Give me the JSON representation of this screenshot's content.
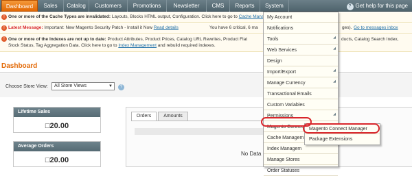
{
  "nav": {
    "items": [
      "Dashboard",
      "Sales",
      "Catalog",
      "Customers",
      "Promotions",
      "Newsletter",
      "CMS",
      "Reports",
      "System"
    ],
    "help": "Get help for this page"
  },
  "messages": {
    "cache_bold": "One or more of the Cache Types are invalidated:",
    "cache_text": "Layouts, Blocks HTML output, Configuration. Click here to go to",
    "cache_link": "Cache Management",
    "latest_bold": "Latest Message:",
    "latest_text": "Important: New Magento Security Patch - Install it Now",
    "latest_link": "Read details",
    "latest_right": "You have 6 critical, 6 ma",
    "latest_right2": "ges).",
    "latest_link2": "Go to messages inbox",
    "index_bold": "One or more of the Indexes are not up to date:",
    "index_text1": "Product Attributes, Product Prices, Catalog URL Rewrites, Product Flat",
    "index_text1b": "ducts, Catalog Search Index,",
    "index_text2": "Stock Status, Tag Aggregation Data. Click here to go to",
    "index_link": "Index Management",
    "index_text3": "and rebuild required indexes."
  },
  "page": {
    "title": "Dashboard",
    "store_label": "Choose Store View:",
    "store_value": "All Store Views",
    "help_glyph": "?"
  },
  "stats": [
    {
      "label": "Lifetime Sales",
      "value": "□20.00"
    },
    {
      "label": "Average Orders",
      "value": "□20.00"
    }
  ],
  "tabs": [
    "Orders",
    "Amounts"
  ],
  "no_data": "No Data",
  "menu": {
    "items": [
      {
        "label": "My Account",
        "arrow": false
      },
      {
        "label": "Notifications",
        "arrow": false
      },
      {
        "label": "Tools",
        "arrow": true
      },
      {
        "label": "Web Services",
        "arrow": true
      },
      {
        "label": "Design",
        "arrow": false
      },
      {
        "label": "Import/Export",
        "arrow": true
      },
      {
        "label": "Manage Currency",
        "arrow": true
      },
      {
        "label": "Transactional Emails",
        "arrow": false
      },
      {
        "label": "Custom Variables",
        "arrow": false
      },
      {
        "label": "Permissions",
        "arrow": true
      },
      {
        "label": "Magento Connect",
        "arrow": true
      },
      {
        "label": "Cache Managem",
        "arrow": false
      },
      {
        "label": "Index Managem",
        "arrow": false
      },
      {
        "label": "Manage Stores",
        "arrow": false
      },
      {
        "label": "Order Statuses",
        "arrow": false
      }
    ],
    "submenu": [
      "Magento Connect Manager",
      "Package Extensions"
    ]
  },
  "colors": {
    "accent": "#e26703",
    "highlight": "#d8262b",
    "nav": "#566b74"
  }
}
